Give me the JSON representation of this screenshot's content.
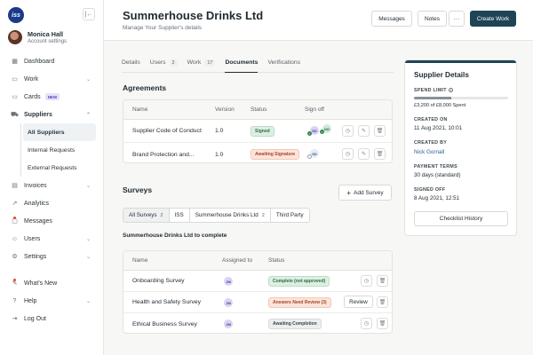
{
  "header": {
    "title": "Summerhouse Drinks Ltd",
    "subtitle": "Manage Your Supplier's details",
    "messages_label": "Messages",
    "notes_label": "Notes",
    "more_label": "···",
    "create_work_label": "Create Work"
  },
  "sidebar": {
    "logo_text": "iss",
    "user_name": "Monica Hall",
    "user_sub": "Account settings",
    "items": {
      "dashboard": "Dashboard",
      "work": "Work",
      "cards": "Cards",
      "cards_badge": "NEW",
      "suppliers": "Suppliers",
      "all_suppliers": "All Suppliers",
      "internal_requests": "Internal Requests",
      "external_requests": "External Requests",
      "invoices": "Invoices",
      "analytics": "Analytics",
      "messages": "Messages",
      "users": "Users",
      "settings": "Settings",
      "whats_new": "What's New",
      "help": "Help",
      "logout": "Log Out"
    }
  },
  "tabs": {
    "details": "Details",
    "users": "Users",
    "users_count": "2",
    "work": "Work",
    "work_count": "17",
    "documents": "Documents",
    "verifications": "Verifications"
  },
  "agreements": {
    "title": "Agreements",
    "columns": {
      "name": "Name",
      "version": "Version",
      "status": "Status",
      "signoff": "Sign off"
    },
    "rows": [
      {
        "name": "Supplier Code of Conduct",
        "version": "1.0",
        "status": "Signed",
        "signers": [
          "SD",
          "NG"
        ]
      },
      {
        "name": "Brand Protection and...",
        "version": "1.0",
        "status": "Awaiting Signature",
        "signers": [
          "SD"
        ]
      }
    ]
  },
  "surveys": {
    "title": "Surveys",
    "add_label": "Add Survey",
    "filters": [
      {
        "label": "All Surveys",
        "count": "2"
      },
      {
        "label": "ISS",
        "count": ""
      },
      {
        "label": "Summerhouse Drinks Ltd",
        "count": "2"
      },
      {
        "label": "Third Party",
        "count": ""
      }
    ],
    "subheading": "Summerhouse Drinks Ltd to complete",
    "columns": {
      "name": "Name",
      "assigned": "Assigned to",
      "status": "Status"
    },
    "rows": [
      {
        "name": "Onboarding Survey",
        "assigned": "JM",
        "status": "Complete (not approved)"
      },
      {
        "name": "Health and Safety Survey",
        "assigned": "JM",
        "status": "Answers Need Review (3)",
        "action": "Review"
      },
      {
        "name": "Ethical Business Survey",
        "assigned": "JM",
        "status": "Awaiting Completion"
      }
    ]
  },
  "supplier_details": {
    "title": "Supplier Details",
    "spend_limit_label": "SPEND LIMIT",
    "spend_fraction": 0.4,
    "spend_text": "£3,200 of £8,000 Spent",
    "created_on_label": "CREATED ON",
    "created_on": "11 Aug 2021, 10:01",
    "created_by_label": "CREATED BY",
    "created_by": "Nick Gornall",
    "payment_terms_label": "PAYMENT TERMS",
    "payment_terms": "30 days (standard)",
    "signed_off_label": "SIGNED OFF",
    "signed_off": "8 Aug 2021, 12:51",
    "checklist_label": "Checklist History"
  },
  "colors": {
    "primary": "#1f4456",
    "signed": "#2e6b43",
    "awaiting": "#a2472a",
    "link": "#2a5f9e"
  }
}
